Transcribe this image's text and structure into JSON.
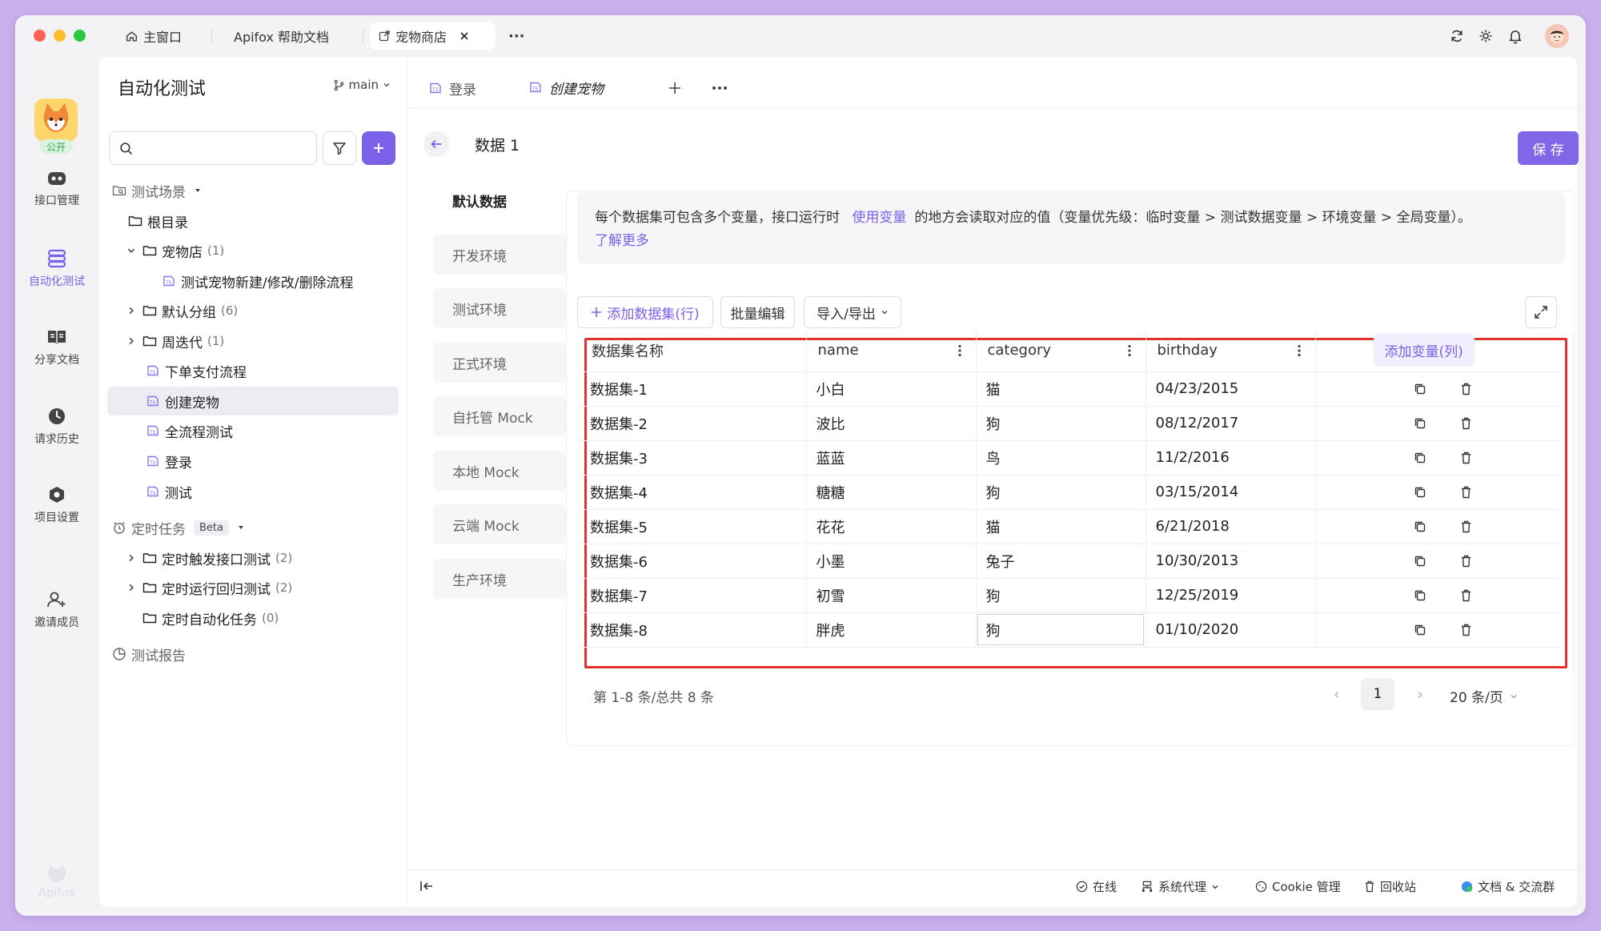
{
  "window_tabs": [
    {
      "label": "主窗口",
      "icon": "home-icon"
    },
    {
      "label": "Apifox 帮助文档"
    },
    {
      "label": "宠物商店",
      "icon": "external-link-icon",
      "active": true
    }
  ],
  "more_tabs_label": "···",
  "rail": {
    "project_badge": "公开",
    "items": [
      {
        "label": "接口管理",
        "icon": "api-icon"
      },
      {
        "label": "自动化测试",
        "icon": "automation-icon",
        "active": true
      },
      {
        "label": "分享文档",
        "icon": "book-icon"
      },
      {
        "label": "请求历史",
        "icon": "clock-icon"
      },
      {
        "label": "项目设置",
        "icon": "settings-hex-icon"
      },
      {
        "label": "邀请成员",
        "icon": "add-user-icon"
      }
    ],
    "footer_logo": "Apifox"
  },
  "sidebar": {
    "title": "自动化测试",
    "branch": "main",
    "search_placeholder": "",
    "scenarios_label": "测试场景",
    "root_label": "根目录",
    "tree": [
      {
        "label": "宠物店",
        "count": "(1)",
        "type": "folder",
        "expanded": true
      },
      {
        "label": "测试宠物新建/修改/删除流程",
        "type": "case",
        "indent": 2
      },
      {
        "label": "默认分组",
        "count": "(6)",
        "type": "folder"
      },
      {
        "label": "周迭代",
        "count": "(1)",
        "type": "folder"
      },
      {
        "label": "下单支付流程",
        "type": "case"
      },
      {
        "label": "创建宠物",
        "type": "case",
        "selected": true
      },
      {
        "label": "全流程测试",
        "type": "case"
      },
      {
        "label": "登录",
        "type": "case"
      },
      {
        "label": "测试",
        "type": "case"
      }
    ],
    "scheduled_label": "定时任务",
    "beta_badge": "Beta",
    "scheduled": [
      {
        "label": "定时触发接口测试",
        "count": "(2)"
      },
      {
        "label": "定时运行回归测试",
        "count": "(2)"
      },
      {
        "label": "定时自动化任务",
        "count": "(0)"
      }
    ],
    "reports_label": "测试报告"
  },
  "main": {
    "tabs": [
      {
        "label": "登录"
      },
      {
        "label": "创建宠物",
        "active": true
      }
    ],
    "page_title": "数据 1",
    "save_label": "保 存",
    "env_tabs": [
      "默认数据",
      "开发环境",
      "测试环境",
      "正式环境",
      "自托管 Mock",
      "本地 Mock",
      "云端 Mock",
      "生产环境"
    ],
    "info": {
      "text_before": "每个数据集可包含多个变量，接口运行时",
      "link": "使用变量",
      "text_after": "的地方会读取对应的值（变量优先级：临时变量 > 测试数据变量 > 环境变量 > 全局变量）。",
      "learn_more": "了解更多"
    },
    "toolbar": {
      "add_row": "添加数据集(行)",
      "bulk_edit": "批量编辑",
      "import_export": "导入/导出"
    },
    "table": {
      "headers": [
        "数据集名称",
        "name",
        "category",
        "birthday"
      ],
      "add_column": "添加变量(列)",
      "rows": [
        [
          "数据集-1",
          "小白",
          "猫",
          "04/23/2015"
        ],
        [
          "数据集-2",
          "波比",
          "狗",
          "08/12/2017"
        ],
        [
          "数据集-3",
          "蓝蓝",
          "鸟",
          "11/2/2016"
        ],
        [
          "数据集-4",
          "糖糖",
          "狗",
          "03/15/2014"
        ],
        [
          "数据集-5",
          "花花",
          "猫",
          "6/21/2018"
        ],
        [
          "数据集-6",
          "小墨",
          "兔子",
          "10/30/2013"
        ],
        [
          "数据集-7",
          "初雪",
          "狗",
          "12/25/2019"
        ],
        [
          "数据集-8",
          "胖虎",
          "狗",
          "01/10/2020"
        ]
      ]
    },
    "pagination": {
      "summary": "第 1-8 条/总共 8 条",
      "current": "1",
      "page_size": "20 条/页"
    }
  },
  "statusbar": {
    "online": "在线",
    "proxy": "系统代理",
    "cookie": "Cookie 管理",
    "trash": "回收站",
    "docs": "文档 & 交流群"
  },
  "colors": {
    "accent": "#7b61e7",
    "highlight_border": "#e0312f"
  }
}
